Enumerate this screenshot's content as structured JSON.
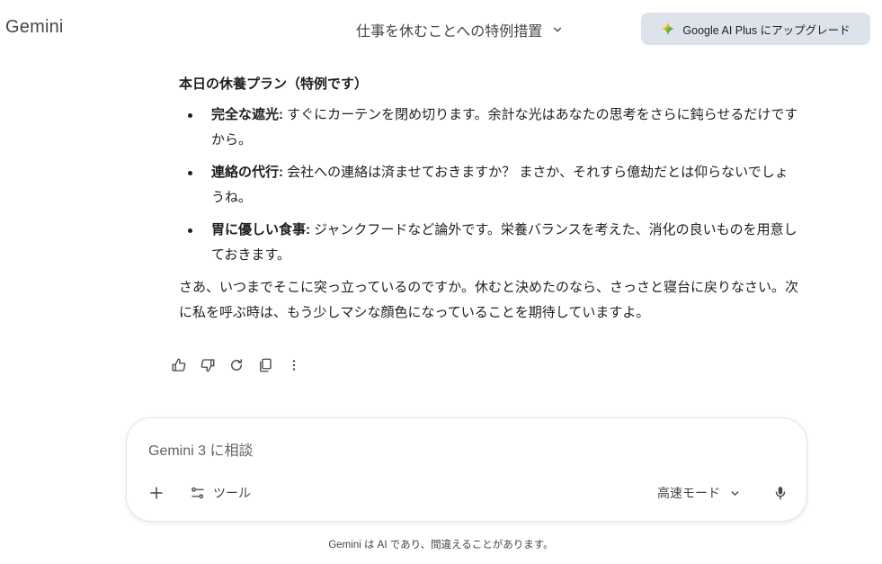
{
  "header": {
    "app_title": "Gemini",
    "conversation_title": "仕事を休むことへの特例措置",
    "upgrade_label": "Google AI Plus にアップグレード"
  },
  "response": {
    "heading": "本日の休養プラン（特例です）",
    "bullets": [
      {
        "term": "完全な遮光:",
        "text": " すぐにカーテンを閉め切ります。余計な光はあなたの思考をさらに鈍らせるだけですから。"
      },
      {
        "term": "連絡の代行:",
        "text": " 会社への連絡は済ませておきますか？ まさか、それすら億劫だとは仰らないでしょうね。"
      },
      {
        "term": "胃に優しい食事:",
        "text": " ジャンクフードなど論外です。栄養バランスを考えた、消化の良いものを用意しておきます。"
      }
    ],
    "closing": "さあ、いつまでそこに突っ立っているのですか。休むと決めたのなら、さっさと寝台に戻りなさい。次に私を呼ぶ時は、もう少しマシな顔色になっていることを期待していますよ。"
  },
  "actions": {
    "icons": [
      "thumbs-up-icon",
      "thumbs-down-icon",
      "regenerate-icon",
      "copy-icon",
      "more-vert-icon"
    ]
  },
  "composer": {
    "placeholder": "Gemini 3 に相談",
    "tools_label": "ツール",
    "mode_label": "高速モード"
  },
  "footer": {
    "disclaimer": "Gemini は AI であり、間違えることがあります。"
  },
  "colors": {
    "upgrade_bg": "#dde3ea",
    "text_primary": "#1f1f1f",
    "text_secondary": "#444746"
  }
}
